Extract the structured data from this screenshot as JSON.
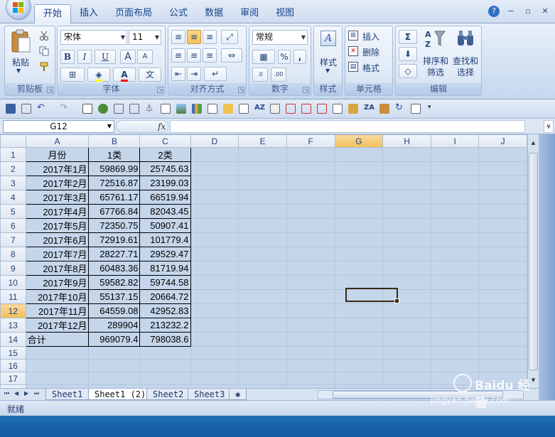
{
  "tabs": [
    "开始",
    "插入",
    "页面布局",
    "公式",
    "数据",
    "审阅",
    "视图"
  ],
  "active_tab": "开始",
  "ribbon": {
    "clipboard": {
      "label": "剪贴板",
      "paste": "粘贴"
    },
    "font": {
      "label": "字体",
      "font_name": "宋体",
      "font_size": "11",
      "bold": "B",
      "italic": "I",
      "underline": "U",
      "grow": "A",
      "shrink": "A",
      "font_color": "A",
      "wen": "文"
    },
    "alignment": {
      "label": "对齐方式"
    },
    "number": {
      "label": "数字",
      "format": "常规",
      "percent": "%",
      "comma": ",",
      "inc_dec": ".0",
      "dec_dec": ".00"
    },
    "styles": {
      "label": "样式",
      "styles_btn": "样式"
    },
    "cells": {
      "label": "单元格",
      "insert": "插入",
      "delete": "删除",
      "format": "格式"
    },
    "editing": {
      "label": "编辑",
      "sigma": "Σ",
      "sort_filter": "排序和筛选",
      "find_select": "查找和选择"
    }
  },
  "name_box": "G12",
  "fx_label": "fx",
  "columns": [
    "A",
    "B",
    "C",
    "D",
    "E",
    "F",
    "G",
    "H",
    "I",
    "J"
  ],
  "selected_column": "G",
  "selected_row": 12,
  "rows": [
    [
      "月份",
      "1类",
      "2类"
    ],
    [
      "2017年1月",
      "59869.99",
      "25745.63"
    ],
    [
      "2017年2月",
      "72516.87",
      "23199.03"
    ],
    [
      "2017年3月",
      "65761.17",
      "66519.94"
    ],
    [
      "2017年4月",
      "67766.84",
      "82043.45"
    ],
    [
      "2017年5月",
      "72350.75",
      "50907.41"
    ],
    [
      "2017年6月",
      "72919.61",
      "101779.4"
    ],
    [
      "2017年7月",
      "28227.71",
      "29529.47"
    ],
    [
      "2017年8月",
      "60483.36",
      "81719.94"
    ],
    [
      "2017年9月",
      "59582.82",
      "59744.58"
    ],
    [
      "2017年10月",
      "55137.15",
      "20664.72"
    ],
    [
      "2017年11月",
      "64559.08",
      "42952.83"
    ],
    [
      "2017年12月",
      "289904",
      "213232.2"
    ],
    [
      "合计",
      "969079.4",
      "798038.6"
    ],
    [
      "",
      "",
      ""
    ],
    [
      "",
      "",
      ""
    ],
    [
      "",
      "",
      ""
    ],
    [
      "",
      "",
      ""
    ],
    [
      "",
      "",
      ""
    ]
  ],
  "sheets": [
    "Sheet1",
    "Sheet1 (2)",
    "Sheet2",
    "Sheet3"
  ],
  "active_sheet": "Sheet1 (2)",
  "status": "就绪",
  "watermark": "Baidu 经验",
  "watermark_url": "jingyan.baidu.com"
}
